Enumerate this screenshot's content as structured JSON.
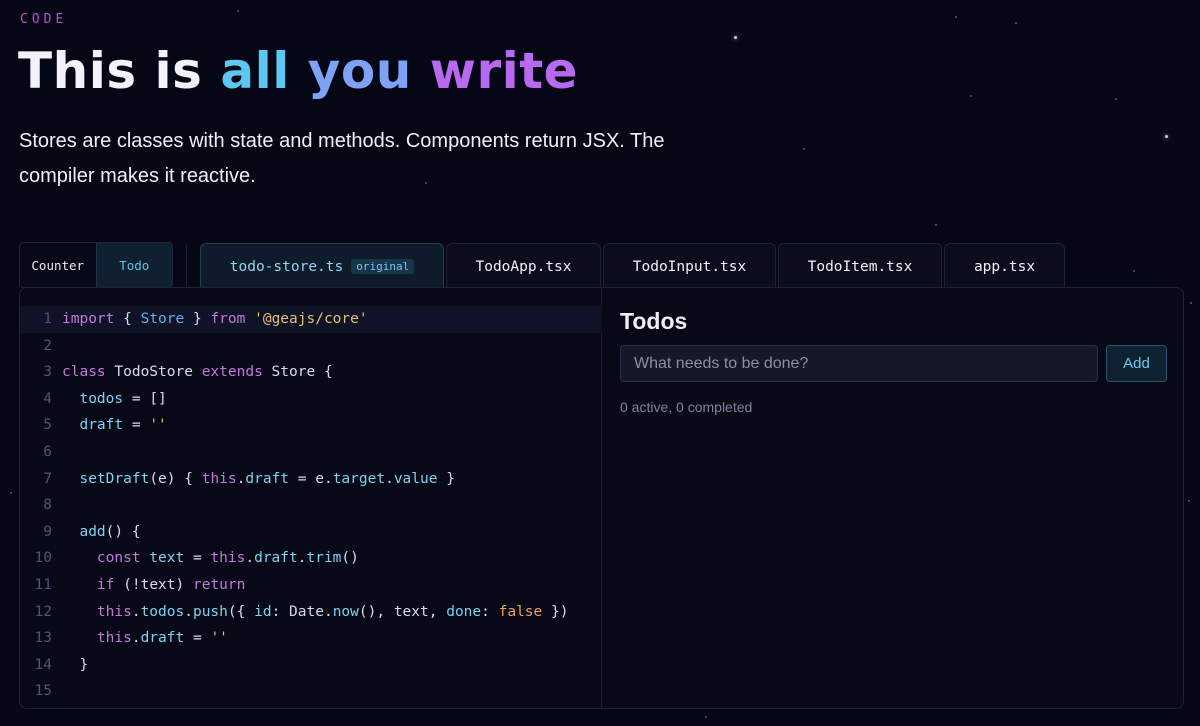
{
  "hero": {
    "eyebrow": "CODE",
    "title_prefix": "This is ",
    "title_word1": "all",
    "title_word2": "you",
    "title_word3": "write",
    "subtitle": "Stores are classes with state and methods. Components return JSX. The compiler makes it reactive."
  },
  "examples": {
    "items": [
      "Counter",
      "Todo"
    ],
    "selected": "Todo"
  },
  "file_tabs": [
    {
      "label": "todo-store.ts",
      "badge": "original",
      "active": true
    },
    {
      "label": "TodoApp.tsx"
    },
    {
      "label": "TodoInput.tsx"
    },
    {
      "label": "TodoItem.tsx"
    },
    {
      "label": "app.tsx"
    }
  ],
  "code": {
    "line_numbers": [
      "1",
      "2",
      "3",
      "4",
      "5",
      "6",
      "7",
      "8",
      "9",
      "10",
      "11",
      "12",
      "13",
      "14",
      "15"
    ],
    "lines": [
      "import { Store } from '@geajs/core'",
      "",
      "class TodoStore extends Store {",
      "  todos = []",
      "  draft = ''",
      "",
      "  setDraft(e) { this.draft = e.target.value }",
      "",
      "  add() {",
      "    const text = this.draft.trim()",
      "    if (!text) return",
      "    this.todos.push({ id: Date.now(), text, done: false })",
      "    this.draft = ''",
      "  }",
      ""
    ]
  },
  "preview": {
    "title": "Todos",
    "input_placeholder": "What needs to be done?",
    "input_value": "",
    "add_label": "Add",
    "status": "0 active, 0 completed"
  }
}
